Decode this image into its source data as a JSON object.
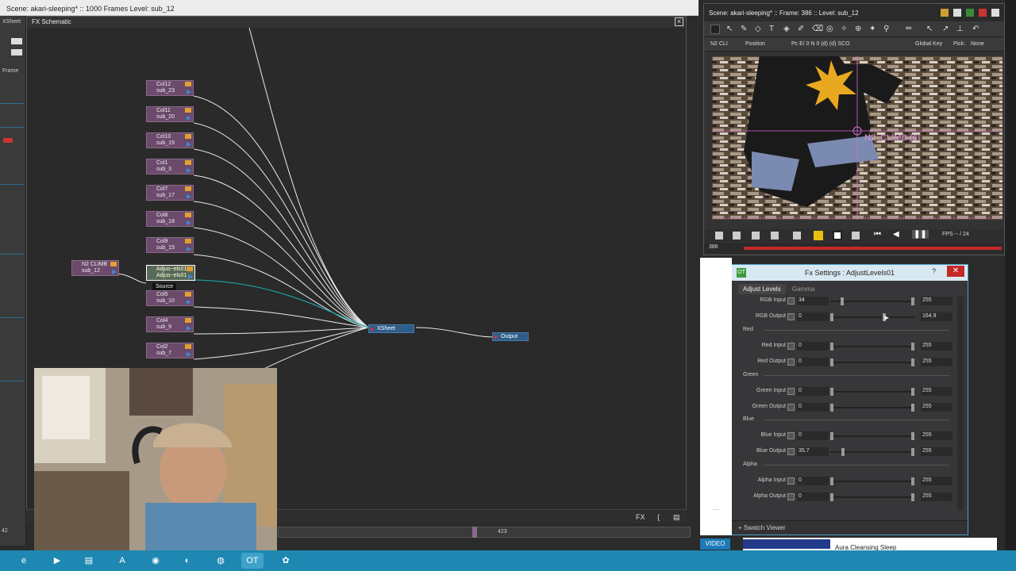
{
  "main_window": {
    "title": "Scene: akari-sleeping*  ::  1000 Frames  Level: sub_12",
    "side_tabs": [
      "XSheet",
      "Frame"
    ],
    "fx_panel_title": "FX Schematic",
    "bottom_buttons": [
      "FX",
      "{",
      "▤"
    ],
    "timeline_frame": "423",
    "left_frame_marker": "42"
  },
  "nodes": [
    {
      "name": "Col12",
      "level": "sub_23"
    },
    {
      "name": "Col11",
      "level": "sub_20"
    },
    {
      "name": "Col10",
      "level": "sub_19"
    },
    {
      "name": "Col1",
      "level": "sub_3"
    },
    {
      "name": "Col7",
      "level": "sub_17"
    },
    {
      "name": "Col8",
      "level": "sub_18"
    },
    {
      "name": "Col9",
      "level": "sub_15"
    },
    {
      "name": "Col5",
      "level": "sub_10"
    },
    {
      "name": "Col4",
      "level": "sub_9"
    },
    {
      "name": "Col2",
      "level": "sub_7"
    }
  ],
  "special_nodes": {
    "n2": {
      "name": "N2 CLIMB",
      "level": "sub_12"
    },
    "adjust": {
      "line1": "Adjus~els01",
      "line2": "Adjus~els01",
      "source": "Source"
    },
    "xsheet": "XSheet",
    "output": "Output"
  },
  "viewer": {
    "title": "Scene: akari-sleeping*  ::  Frame: 386  ::  Level: sub_12",
    "toolbar2": {
      "column": "N2 CLI",
      "mode": "Position",
      "global_key": "Global Key",
      "pick": "Pick:",
      "pick_value": "None"
    },
    "overlay_label": "N2_CLIMB (6)",
    "fps": "FPS -- / 24",
    "frame": "386"
  },
  "fx_settings": {
    "title": "Fx Settings : AdjustLevels01",
    "help": "?",
    "tabs": [
      "Adjust Levels",
      "Gamma"
    ],
    "sections": [
      "Red",
      "Green",
      "Blue",
      "Alpha"
    ],
    "rows": [
      {
        "label": "RGB Input",
        "min": "34",
        "max": "255",
        "h1": 0.13,
        "h2": 1.0
      },
      {
        "label": "RGB Output",
        "min": "0",
        "max": "164.9",
        "h1": 0.0,
        "h2": 0.65
      },
      {
        "label": "Red Input",
        "min": "0",
        "max": "255",
        "h1": 0.0,
        "h2": 1.0
      },
      {
        "label": "Red Output",
        "min": "0",
        "max": "255",
        "h1": 0.0,
        "h2": 1.0
      },
      {
        "label": "Green Input",
        "min": "0",
        "max": "255",
        "h1": 0.0,
        "h2": 1.0
      },
      {
        "label": "Green Output",
        "min": "0",
        "max": "255",
        "h1": 0.0,
        "h2": 1.0
      },
      {
        "label": "Blue Input",
        "min": "0",
        "max": "255",
        "h1": 0.0,
        "h2": 1.0
      },
      {
        "label": "Blue Output",
        "min": "35.7",
        "max": "255",
        "h1": 0.14,
        "h2": 1.0
      },
      {
        "label": "Alpha Input",
        "min": "0",
        "max": "255",
        "h1": 0.0,
        "h2": 1.0
      },
      {
        "label": "Alpha Output",
        "min": "0",
        "max": "255",
        "h1": 0.0,
        "h2": 1.0
      }
    ],
    "footer": "Swatch Viewer"
  },
  "right_panel": {
    "video_tab": "VIDEO",
    "aura_title": "Aura Cleansing Sleep"
  },
  "colors": {
    "taskbar": "#1e88b2",
    "node": "#6b4a6b",
    "link": "#ffffff",
    "selected_link": "#1aa3a3",
    "fx_border": "#4aa0c8"
  }
}
